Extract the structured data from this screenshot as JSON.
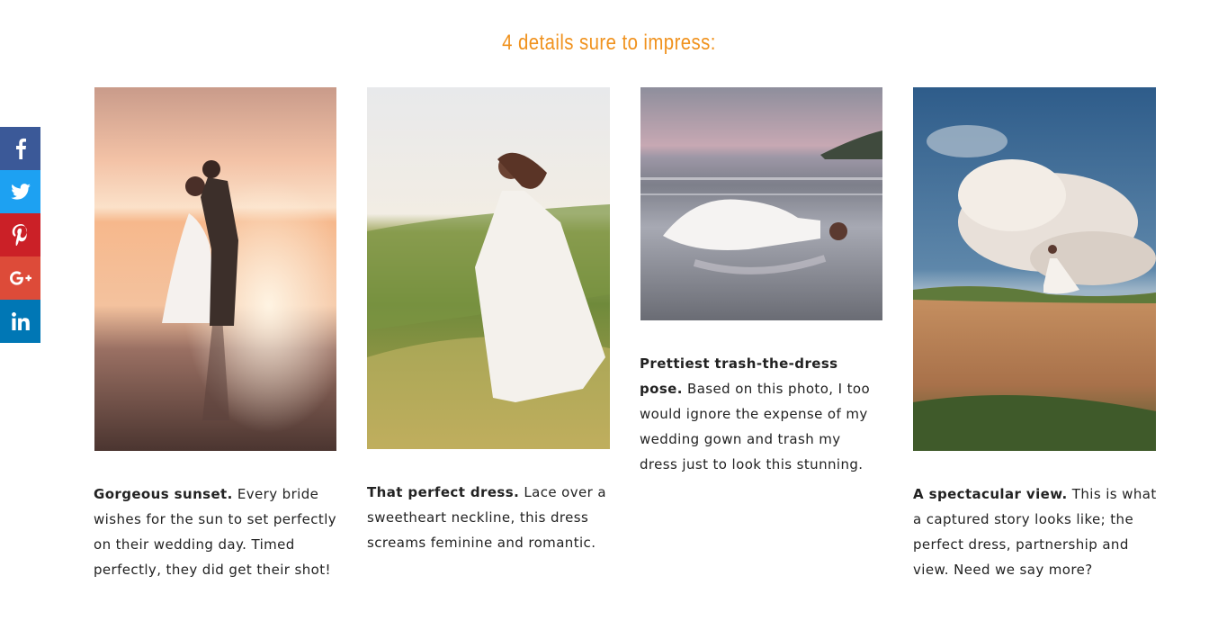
{
  "heading": "4 details sure to impress:",
  "share": [
    {
      "name": "facebook",
      "icon": "facebook-icon",
      "color": "#3b5998"
    },
    {
      "name": "twitter",
      "icon": "twitter-icon",
      "color": "#1da1f2"
    },
    {
      "name": "pinterest",
      "icon": "pinterest-icon",
      "color": "#cb2027"
    },
    {
      "name": "google-plus",
      "icon": "google-plus-icon",
      "color": "#dd4b39"
    },
    {
      "name": "linkedin",
      "icon": "linkedin-icon",
      "color": "#0077b5"
    }
  ],
  "cards": [
    {
      "title": "Gorgeous sunset.",
      "body": " Every bride wishes for the sun to set perfectly on their wedding day. Timed perfectly, they did get their shot!",
      "photo": "couple-at-sunset-on-beach"
    },
    {
      "title": "That perfect dress.",
      "body": " Lace over a sweetheart neckline, this dress screams feminine and romantic.",
      "photo": "bride-on-grassy-hill"
    },
    {
      "title": "Prettiest trash-the-dress pose.",
      "body": " Based on this photo, I too would ignore the expense of my wedding gown and trash my dress just to look this stunning.",
      "photo": "bride-lying-in-surf"
    },
    {
      "title": "A spectacular view.",
      "body": " This is what a captured story looks like; the perfect dress, partnership and view. Need we say more?",
      "photo": "bride-on-cliff-edge"
    }
  ],
  "colors": {
    "accent": "#f0921e"
  }
}
